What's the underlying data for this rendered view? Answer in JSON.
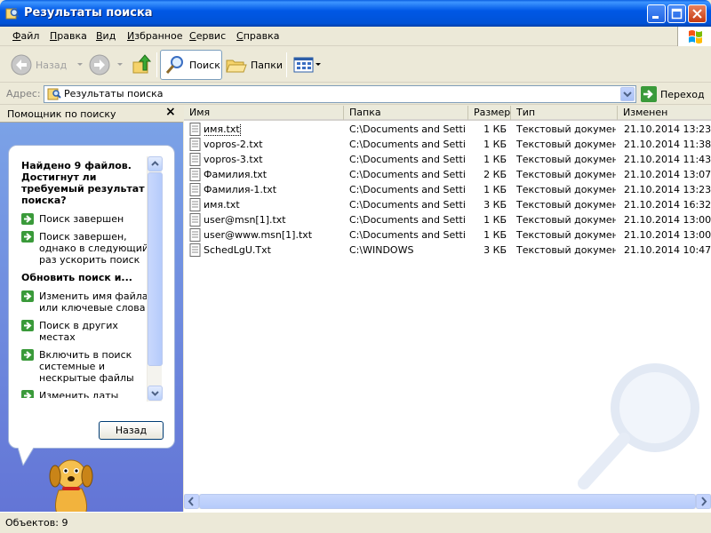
{
  "window": {
    "title": "Результаты поиска"
  },
  "menu": [
    {
      "label": "Файл",
      "key": "Ф",
      "rest": "айл"
    },
    {
      "label": "Правка",
      "key": "П",
      "rest": "равка"
    },
    {
      "label": "Вид",
      "key": "В",
      "rest": "ид"
    },
    {
      "label": "Избранное",
      "key": "И",
      "rest": "збранное"
    },
    {
      "label": "Сервис",
      "key": "С",
      "rest": "ервис"
    },
    {
      "label": "Справка",
      "key": "С",
      "rest": "правка"
    }
  ],
  "toolbar": {
    "back_label": "Назад",
    "search_label": "Поиск",
    "folders_label": "Папки"
  },
  "address": {
    "label": "Адрес:",
    "value": "Результаты поиска",
    "go_label": "Переход"
  },
  "search_pane": {
    "header": "Помощник по поиску",
    "close_glyph": "×",
    "heading": "Найдено 9 файлов. Достигнут ли требуемый результат поиска?",
    "options": [
      "Поиск завершен",
      "Поиск завершен, однако в следующий раз ускорить поиск"
    ],
    "refine_heading": "Обновить поиск и...",
    "refine_options": [
      "Изменить имя файла или ключевые слова",
      "Поиск в других местах",
      "Включить в поиск системные и нескрытые файлы",
      "Изменить даты создания или"
    ],
    "back_button": "Назад"
  },
  "columns": [
    "Имя",
    "Папка",
    "Размер",
    "Тип",
    "Изменен"
  ],
  "files": [
    {
      "name": "имя.txt",
      "folder": "C:\\Documents and Setti...",
      "size": "1 КБ",
      "type": "Текстовый документ",
      "modified": "21.10.2014 13:23"
    },
    {
      "name": "vopros-2.txt",
      "folder": "C:\\Documents and Setti...",
      "size": "1 КБ",
      "type": "Текстовый документ",
      "modified": "21.10.2014 11:38"
    },
    {
      "name": "vopros-3.txt",
      "folder": "C:\\Documents and Setti...",
      "size": "1 КБ",
      "type": "Текстовый документ",
      "modified": "21.10.2014 11:43"
    },
    {
      "name": "Фамилия.txt",
      "folder": "C:\\Documents and Setti...",
      "size": "2 КБ",
      "type": "Текстовый документ",
      "modified": "21.10.2014 13:07"
    },
    {
      "name": "Фамилия-1.txt",
      "folder": "C:\\Documents and Setti...",
      "size": "1 КБ",
      "type": "Текстовый документ",
      "modified": "21.10.2014 13:23"
    },
    {
      "name": "имя.txt",
      "folder": "C:\\Documents and Setti...",
      "size": "3 КБ",
      "type": "Текстовый документ",
      "modified": "21.10.2014 16:32"
    },
    {
      "name": "user@msn[1].txt",
      "folder": "C:\\Documents and Setti...",
      "size": "1 КБ",
      "type": "Текстовый документ",
      "modified": "21.10.2014 13:00"
    },
    {
      "name": "user@www.msn[1].txt",
      "folder": "C:\\Documents and Setti...",
      "size": "1 КБ",
      "type": "Текстовый документ",
      "modified": "21.10.2014 13:00"
    },
    {
      "name": "SchedLgU.Txt",
      "folder": "C:\\WINDOWS",
      "size": "3 КБ",
      "type": "Текстовый документ",
      "modified": "21.10.2014 10:47"
    }
  ],
  "status": {
    "text": "Объектов: 9"
  },
  "colors": {
    "titlebar": "#0058E6",
    "task_pane": "#6375D6",
    "arrow_green": "#3A9A3A"
  }
}
